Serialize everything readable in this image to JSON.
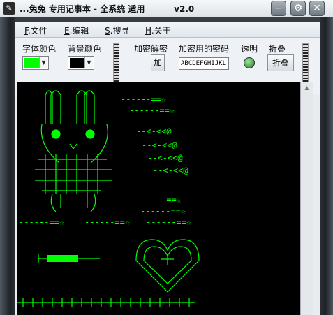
{
  "window": {
    "title": "...兔兔 专用记事本 - 全系统 适用          v2.0",
    "minimize": "−",
    "settings": "⚙",
    "close": "✕"
  },
  "menu": {
    "file": {
      "key": "F",
      "label": ".文件"
    },
    "edit": {
      "key": "E",
      "label": ".编辑"
    },
    "search": {
      "key": "S",
      "label": ".搜寻"
    },
    "about": {
      "key": "H",
      "label": ".关于"
    }
  },
  "toolbar": {
    "font_color_label": "字体颜色",
    "bg_color_label": "背景颜色",
    "encrypt_label": "加密解密",
    "encrypt_button": "加",
    "password_label": "加密用的密码",
    "password_value": "ABCDEFGHIJKL",
    "transparent_label": "透明",
    "fold_label": "折叠",
    "fold_button": "折叠",
    "font_color": "#00ff00",
    "bg_color": "#000000"
  },
  "editor": {
    "text_color": "#00ff00",
    "background": "#000000"
  }
}
